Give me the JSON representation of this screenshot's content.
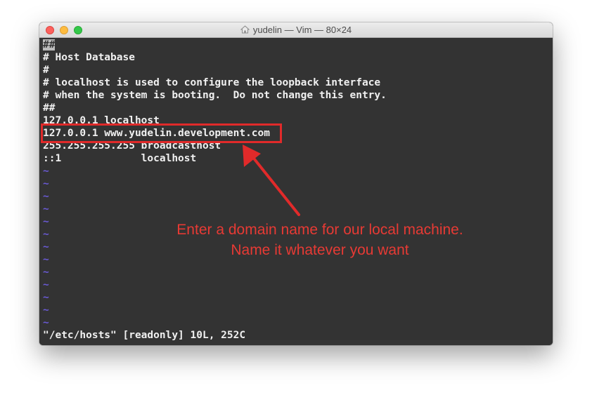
{
  "window": {
    "title": "yudelin — Vim — 80×24",
    "title_icon": "home-folder-icon"
  },
  "buffer": {
    "lines": [
      "##",
      "# Host Database",
      "#",
      "# localhost is used to configure the loopback interface",
      "# when the system is booting.  Do not change this entry.",
      "##",
      "127.0.0.1 localhost",
      "127.0.0.1 www.yudelin.development.com",
      "255.255.255.255 broadcasthost",
      "::1             localhost"
    ],
    "empty_line_marker": "~",
    "status_line": "\"/etc/hosts\" [readonly] 10L, 252C"
  },
  "annotation": {
    "line1": "Enter a domain name for our local machine.",
    "line2": "Name it whatever you want"
  },
  "colors": {
    "terminal_bg": "#333333",
    "text": "#f0f0f0",
    "tilde": "#6a5ad6",
    "annotation_red": "#e12a2a"
  }
}
